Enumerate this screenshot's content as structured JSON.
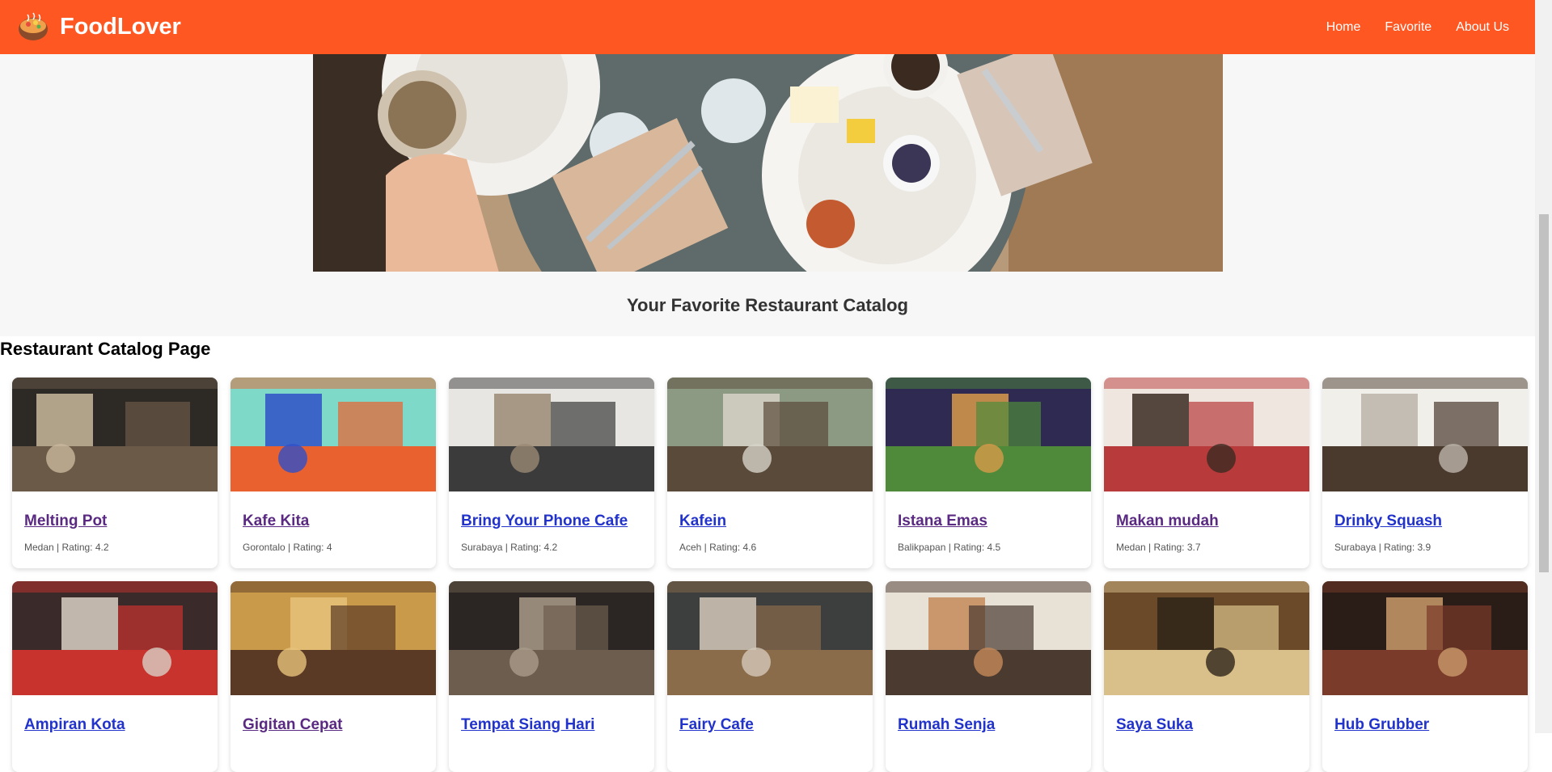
{
  "brand": {
    "name": "FoodLover",
    "icon": "food-bowl-icon"
  },
  "nav": {
    "home": "Home",
    "favorite": "Favorite",
    "about": "About Us"
  },
  "hero": {
    "title": "Your Favorite Restaurant Catalog"
  },
  "catalog": {
    "heading": "Restaurant Catalog Page"
  },
  "restaurants": [
    {
      "name": "Melting Pot",
      "city": "Medan",
      "rating": "4.2",
      "meta": "Medan | Rating: 4.2"
    },
    {
      "name": "Kafe Kita",
      "city": "Gorontalo",
      "rating": "4",
      "meta": "Gorontalo | Rating: 4"
    },
    {
      "name": "Bring Your Phone Cafe",
      "city": "Surabaya",
      "rating": "4.2",
      "meta": "Surabaya | Rating: 4.2"
    },
    {
      "name": "Kafein",
      "city": "Aceh",
      "rating": "4.6",
      "meta": "Aceh | Rating: 4.6"
    },
    {
      "name": "Istana Emas",
      "city": "Balikpapan",
      "rating": "4.5",
      "meta": "Balikpapan | Rating: 4.5"
    },
    {
      "name": "Makan mudah",
      "city": "Medan",
      "rating": "3.7",
      "meta": "Medan | Rating: 3.7"
    },
    {
      "name": "Drinky Squash",
      "city": "Surabaya",
      "rating": "3.9",
      "meta": "Surabaya | Rating: 3.9"
    },
    {
      "name": "Ampiran Kota"
    },
    {
      "name": "Gigitan Cepat"
    },
    {
      "name": "Tempat Siang Hari"
    },
    {
      "name": "Fairy Cafe"
    },
    {
      "name": "Rumah Senja"
    },
    {
      "name": "Saya Suka"
    },
    {
      "name": "Hub Grubber"
    }
  ],
  "colors": {
    "navbar": "#ff5722",
    "link": "#2233cc",
    "visited_link": "#5a2a82"
  }
}
